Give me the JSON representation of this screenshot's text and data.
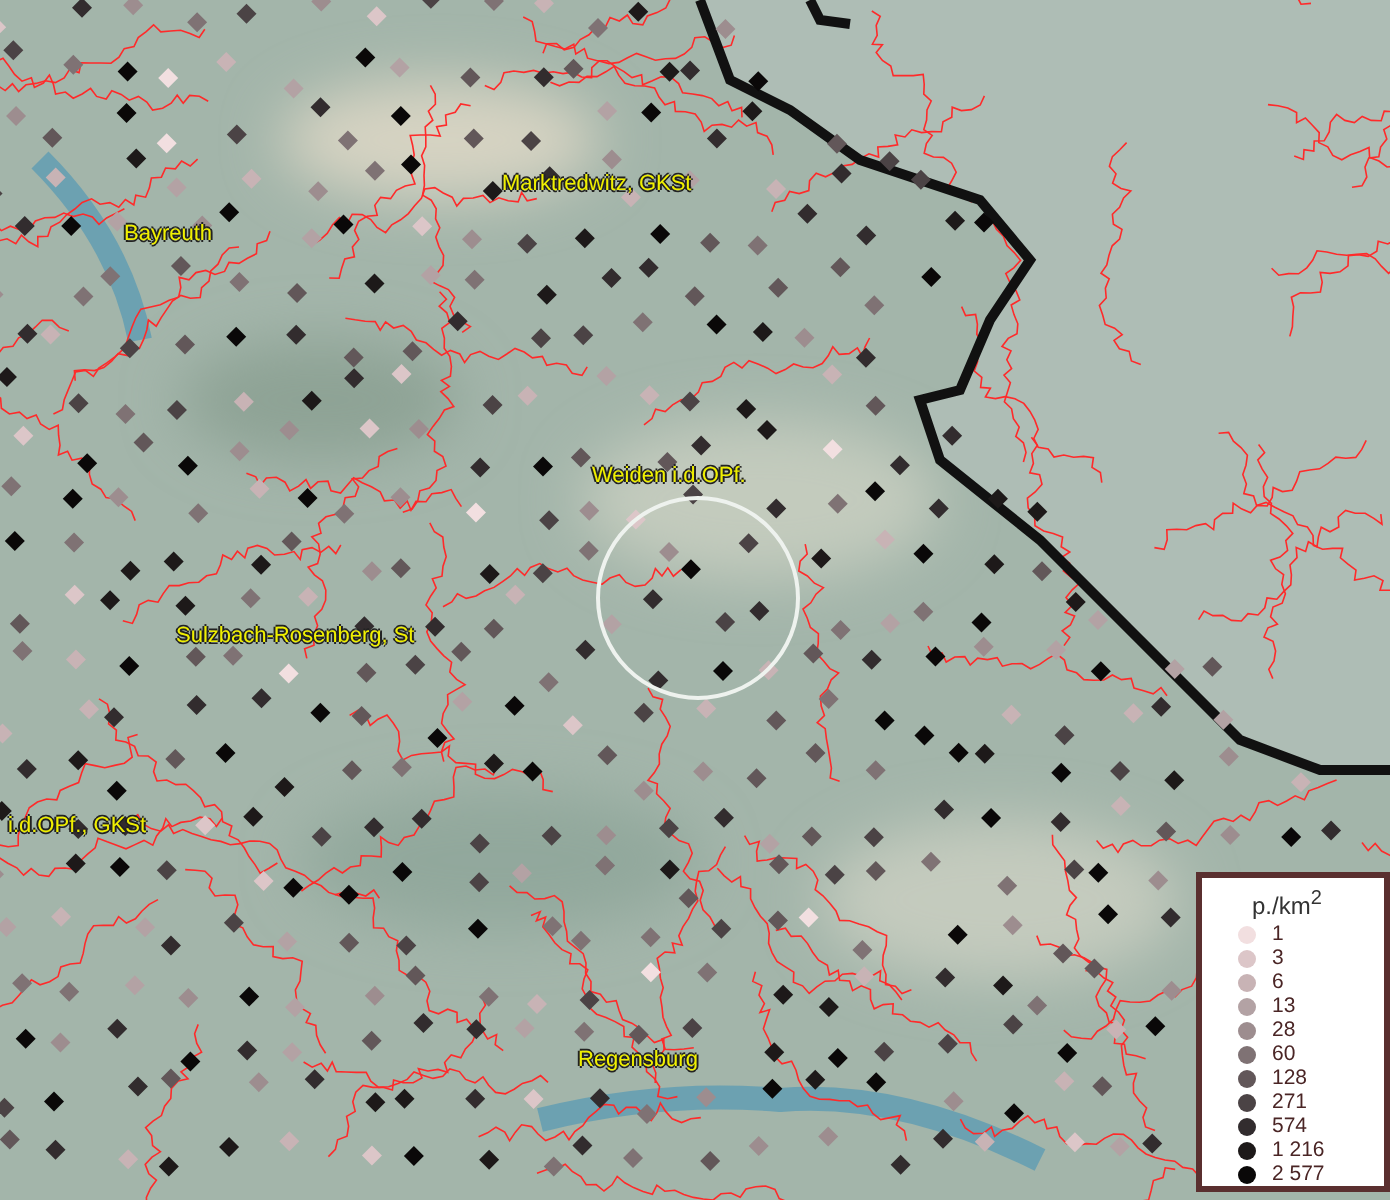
{
  "map": {
    "places": [
      {
        "name": "Marktredwitz, GKSt"
      },
      {
        "name": "Bayreuth"
      },
      {
        "name": "Weiden i.d.OPf."
      },
      {
        "name": "Sulzbach-Rosenberg, St"
      },
      {
        "name": "i.d.OPf., GKSt"
      },
      {
        "name": "Regensburg"
      }
    ]
  },
  "legend": {
    "title": "p./km$^{2}$",
    "items": [
      {
        "label": "1",
        "color": "#f2dfe0"
      },
      {
        "label": "3",
        "color": "#dcc6c8"
      },
      {
        "label": "6",
        "color": "#c8b3b5"
      },
      {
        "label": "13",
        "color": "#b3a2a4"
      },
      {
        "label": "28",
        "color": "#9d8d8f"
      },
      {
        "label": "60",
        "color": "#7f7274"
      },
      {
        "label": "128",
        "color": "#625759"
      },
      {
        "label": "271",
        "color": "#4b4345"
      },
      {
        "label": "574",
        "color": "#322c2e"
      },
      {
        "label": "1 216",
        "color": "#1d1919"
      },
      {
        "label": "2 577",
        "color": "#0a0808"
      }
    ]
  }
}
